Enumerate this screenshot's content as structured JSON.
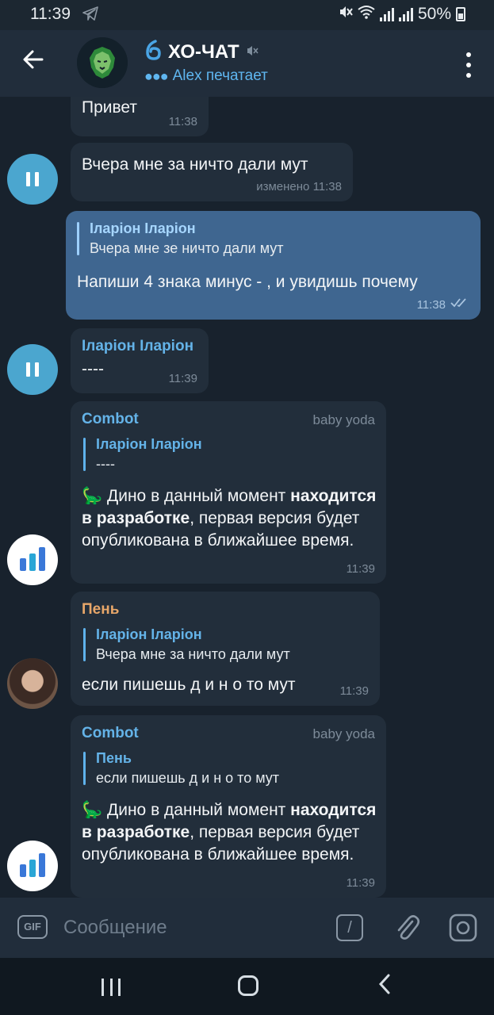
{
  "status_bar": {
    "time": "11:39",
    "battery": "50%"
  },
  "header": {
    "back_icon": "back-arrow-icon",
    "title": "ХО-ЧАТ",
    "typing": "Alex печатает",
    "menu_icon": "more-vertical-icon"
  },
  "messages": {
    "m1": {
      "text": "Привет",
      "time": "11:38"
    },
    "m2": {
      "text": "Вчера мне за ничто дали мут",
      "time": "изменено 11:38"
    },
    "m3": {
      "reply_name": "Іларіон Іларіон",
      "reply_text": "Вчера мне зе ничто дали мут",
      "text": "Напиши 4 знака минус - , и увидишь почему",
      "time": "11:38"
    },
    "m4": {
      "sender": "Іларіон Іларіон",
      "text": "----",
      "time": "11:39"
    },
    "m5": {
      "sender": "Combot",
      "via": "baby yoda",
      "reply_name": "Іларіон Іларіон",
      "reply_text": "----",
      "emoji": "🦕",
      "text_a": "Дино в данный момент",
      "text_bold": "находится в разработке",
      "text_b": ", первая версия будет опубликована в ближайшее время.",
      "time": "11:39"
    },
    "m6": {
      "sender": "Пень",
      "reply_name": "Іларіон Іларіон",
      "reply_text": "Вчера мне за ничто дали мут",
      "text": "если пишешь д и н о то мут",
      "time": "11:39"
    },
    "m7": {
      "sender": "Combot",
      "via": "baby yoda",
      "reply_name": "Пень",
      "reply_text": "если пишешь д и н о то мут",
      "emoji": "🦕",
      "text_a": "Дино в данный момент",
      "text_bold": "находится в разработке",
      "text_b": ", первая версия будет опубликована в ближайшее время.",
      "time": "11:39"
    }
  },
  "composer": {
    "gif_label": "GIF",
    "placeholder": "Сообщение",
    "cmd_label": "/"
  },
  "colors": {
    "outgoing_bubble": "#3f6690",
    "incoming_bubble": "#222e3b",
    "accent": "#64b3e8",
    "sender_orange": "#e7a669"
  }
}
